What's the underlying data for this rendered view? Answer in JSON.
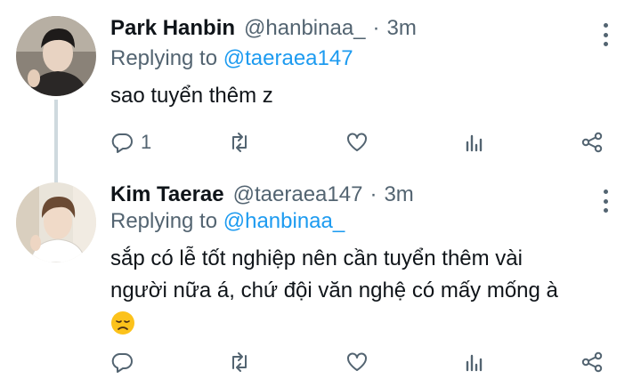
{
  "tweets": [
    {
      "author_name": "Park Hanbin",
      "handle": "@hanbinaa_",
      "separator": "·",
      "time": "3m",
      "replying_prefix": "Replying to ",
      "replying_to": "@taeraea147",
      "text": "sao tuyển thêm z",
      "reply_count": "1",
      "icons": [
        "reply-icon",
        "retweet-icon",
        "like-icon",
        "analytics-icon",
        "share-icon",
        "more-icon"
      ]
    },
    {
      "author_name": "Kim Taerae",
      "handle": "@taeraea147",
      "separator": "·",
      "time": "3m",
      "replying_prefix": "Replying to ",
      "replying_to": "@hanbinaa_",
      "text_line1": "sắp có lễ tốt nghiệp nên cần tuyển thêm vài",
      "text_line2": "người nữa á, chứ đội văn nghệ có mấy mống à",
      "emoji": "disappointed-face-emoji",
      "reply_count": "",
      "icons": [
        "reply-icon",
        "retweet-icon",
        "like-icon",
        "analytics-icon",
        "share-icon",
        "more-icon"
      ]
    }
  ],
  "colors": {
    "text": "#0f1419",
    "secondary": "#536471",
    "link": "#1d9bf0",
    "thread_line": "#cfd9de"
  }
}
